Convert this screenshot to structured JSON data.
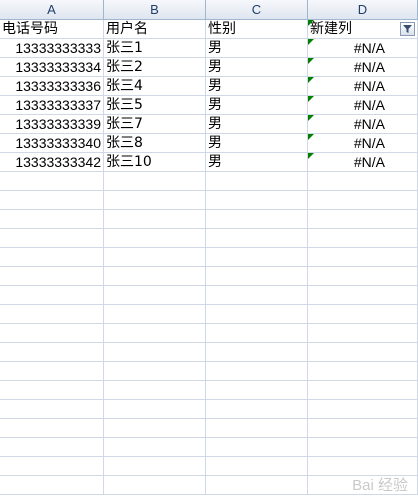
{
  "columns": [
    "A",
    "B",
    "C",
    "D"
  ],
  "headers": [
    "电话号码",
    "用户名",
    "性别",
    "新建列"
  ],
  "rows": [
    [
      "13333333333",
      "张三1",
      "男",
      "#N/A"
    ],
    [
      "13333333334",
      "张三2",
      "男",
      "#N/A"
    ],
    [
      "13333333336",
      "张三4",
      "男",
      "#N/A"
    ],
    [
      "13333333337",
      "张三5",
      "男",
      "#N/A"
    ],
    [
      "13333333339",
      "张三7",
      "男",
      "#N/A"
    ],
    [
      "13333333340",
      "张三8",
      "男",
      "#N/A"
    ],
    [
      "13333333342",
      "张三10",
      "男",
      "#N/A"
    ]
  ],
  "watermark": "Bai 经验",
  "icons": {
    "filter": "filter-icon",
    "error_indicator": "error-indicator-triangle"
  },
  "colors": {
    "header_bg": "#dfe6f0",
    "grid": "#d0d7e5",
    "error_mark": "#008000"
  }
}
